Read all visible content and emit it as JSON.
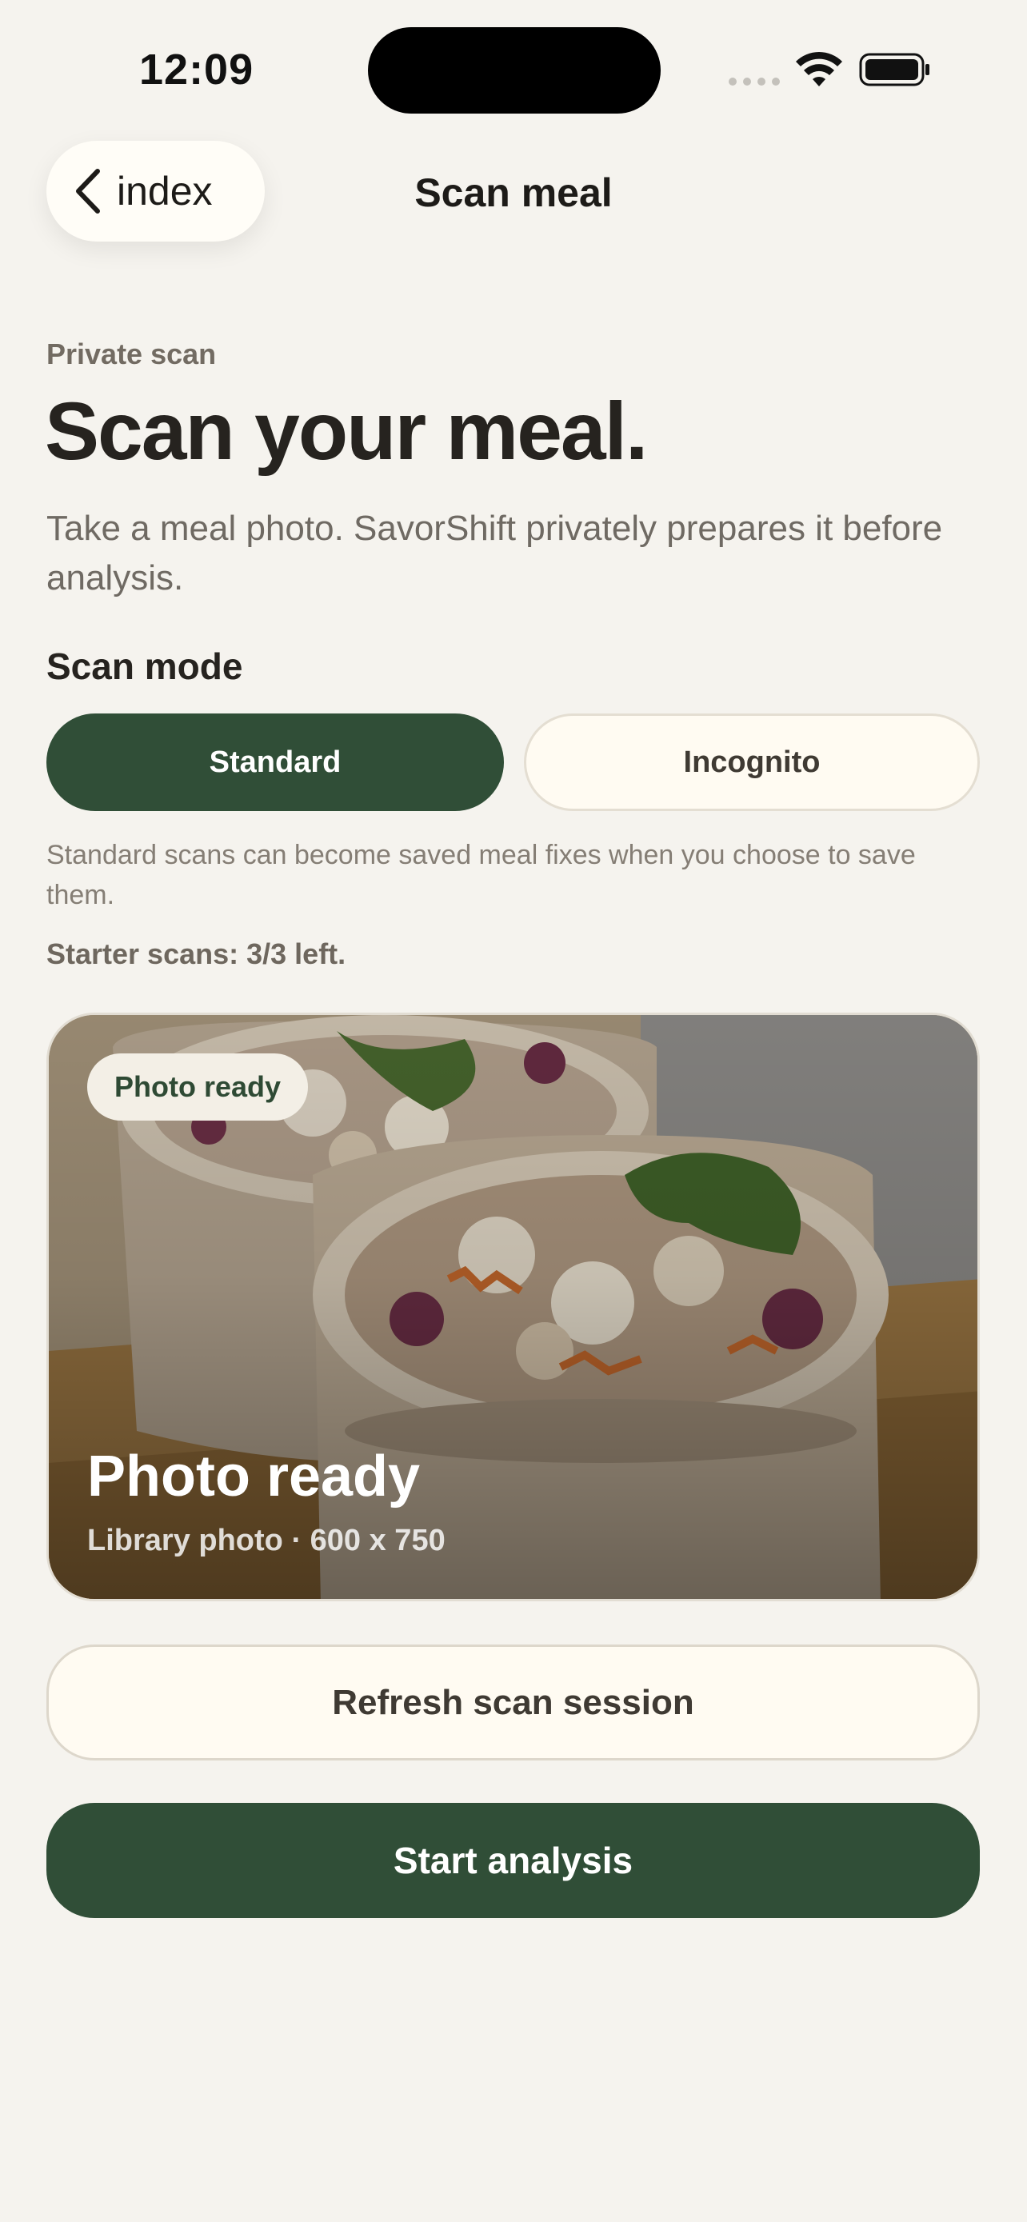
{
  "status_bar": {
    "time": "12:09"
  },
  "nav": {
    "back_label": "index",
    "title": "Scan meal"
  },
  "header": {
    "eyebrow": "Private scan",
    "headline": "Scan your meal.",
    "subtext": "Take a meal photo. SavorShift privately prepares it before analysis."
  },
  "scan_mode": {
    "title": "Scan mode",
    "options": [
      "Standard",
      "Incognito"
    ],
    "selected": "Standard",
    "helper": "Standard scans can become saved meal fixes when you choose to save them.",
    "starter_scans": "Starter scans: 3/3 left."
  },
  "photo": {
    "badge": "Photo ready",
    "title": "Photo ready",
    "meta": "Library photo · 600 x 750"
  },
  "actions": {
    "refresh_label": "Refresh scan session",
    "start_label": "Start analysis"
  },
  "colors": {
    "accent": "#304e37",
    "background": "#f5f3ee",
    "surface": "#fffbf2"
  }
}
